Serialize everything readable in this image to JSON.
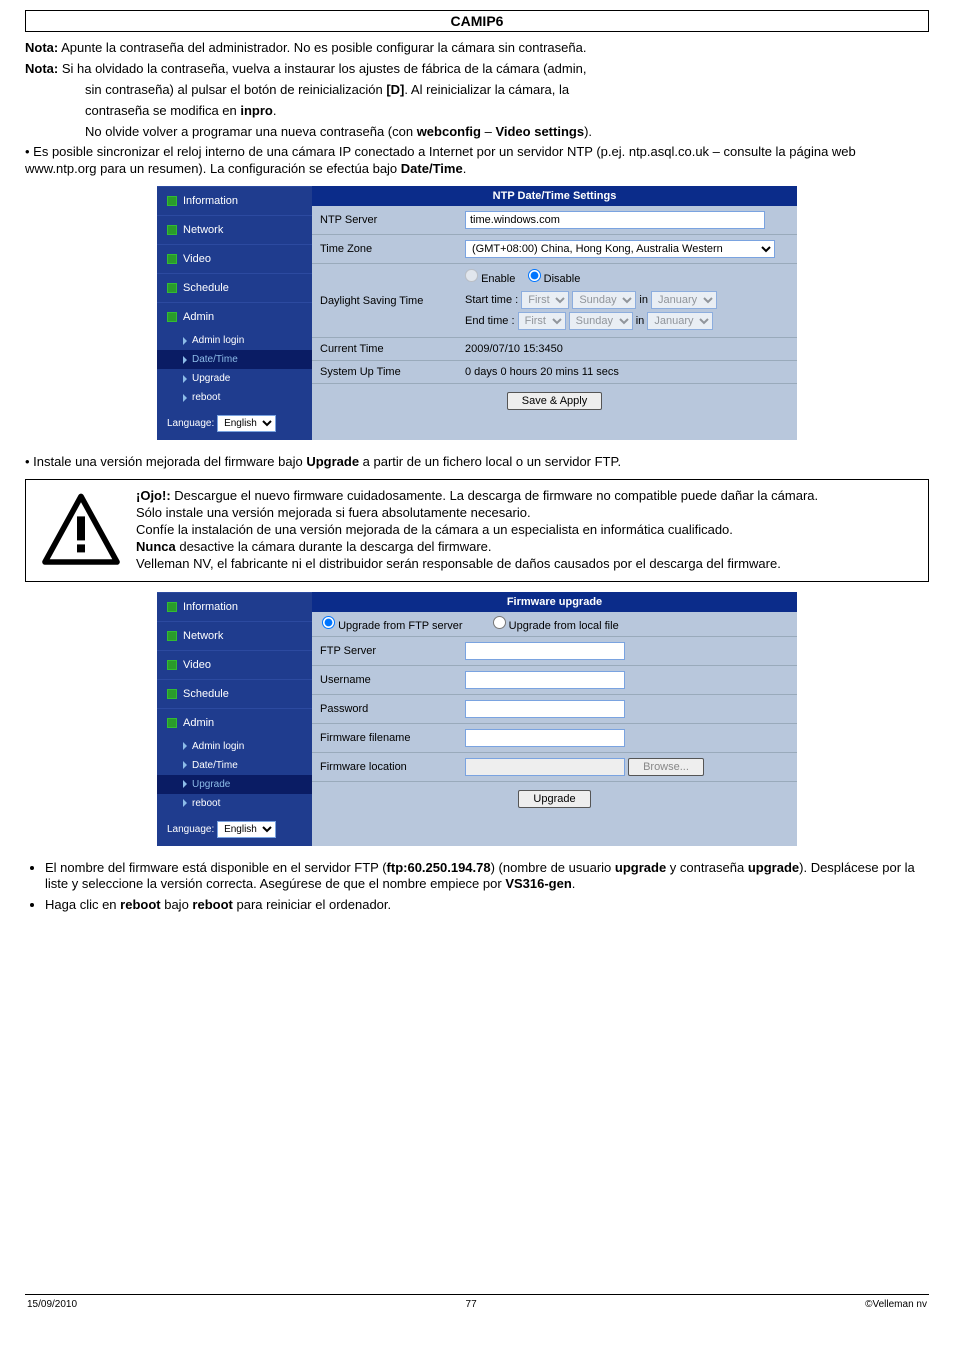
{
  "header": {
    "title": "CAMIP6"
  },
  "intro": {
    "nota1_b": "Nota:",
    "nota1_t": " Apunte la contraseña del administrador. No es posible configurar la cámara sin contraseña.",
    "nota2_b": "Nota:",
    "nota2_t": " Si ha olvidado la contraseña, vuelva a instaurar los ajustes de fábrica de la cámara (admin,",
    "nota2_c1": "sin contraseña) al pulsar el botón de reinicialización ",
    "nota2_c1b": "[D]",
    "nota2_c1t": ". Al reinicializar la cámara, la",
    "nota2_c2": "contraseña se modifica en ",
    "nota2_c2b": "inpro",
    "nota2_c2t": ".",
    "nota2_c3": "No olvide volver a programar una nueva contraseña (con ",
    "nota2_c3b": "webconfig",
    "nota2_c3m": " – ",
    "nota2_c3b2": "Video settings",
    "nota2_c3t": ").",
    "b1a": "Es posible sincronizar el reloj interno de una cámara IP conectado a Internet por un servidor NTP (p.ej. ntp.asql.co.uk – consulte la página web www.ntp.org para un resumen). La configuración se efectúa bajo ",
    "b1ab": "Date/Time",
    "b1at": "."
  },
  "ntp": {
    "hdr": "NTP Date/Time Settings",
    "s1": "Information",
    "s2": "Network",
    "s3": "Video",
    "s4": "Schedule",
    "s5": "Admin",
    "ss1": "Admin login",
    "ss2": "Date/Time",
    "ss3": "Upgrade",
    "ss4": "reboot",
    "lang_lbl": "Language:",
    "lang_val": "English",
    "r1l": "NTP Server",
    "r1v": "time.windows.com",
    "r2l": "Time Zone",
    "r2v": "(GMT+08:00) China, Hong Kong, Australia Western",
    "r3l": "Daylight Saving Time",
    "en": "Enable",
    "di": "Disable",
    "st": "Start time :",
    "et": "End time  :",
    "first": "First",
    "sunday": "Sunday",
    "inw": "in",
    "jan": "January",
    "r4l": "Current Time",
    "r4v": "2009/07/10 15:3450",
    "r5l": "System Up Time",
    "r5v": "0 days 0 hours 20 mins 11 secs",
    "btn": "Save & Apply"
  },
  "mid": {
    "b2": "Instale una versión mejorada del firmware bajo ",
    "b2b": "Upgrade",
    "b2t": " a partir de un fichero local o un servidor FTP."
  },
  "warn": {
    "l1b": "¡Ojo!:",
    "l1": " Descargue el nuevo firmware cuidadosamente. La descarga de firmware no compatible puede dañar la cámara.",
    "l2": "Sólo instale una versión mejorada si fuera absolutamente necesario.",
    "l3": "Confíe la instalación de una versión mejorada de la cámara a un especialista en informática cualificado.",
    "l4b": "Nunca",
    "l4": " desactive la cámara durante la descarga del firmware.",
    "l5": "Velleman NV, el fabricante ni el distribuidor serán responsable de daños causados por el descarga del firmware."
  },
  "fw": {
    "hdr": "Firmware upgrade",
    "opt1": "Upgrade from FTP server",
    "opt2": "Upgrade from local file",
    "r1": "FTP Server",
    "r2": "Username",
    "r3": "Password",
    "r4": "Firmware filename",
    "r5": "Firmware location",
    "browse": "Browse...",
    "up": "Upgrade"
  },
  "tail": {
    "t1a": "El nombre del firmware está disponible en el servidor FTP (",
    "t1b": "ftp:60.250.194.78",
    "t1c": ") (nombre de usuario ",
    "t1d": "upgrade",
    "t1e": " y contraseña ",
    "t1f": "upgrade",
    "t1g": "). Desplácese por la liste y seleccione la versión correcta. Asegúrese de que el nombre empiece por ",
    "t1h": "VS316-gen",
    "t1i": ".",
    "t2a": "Haga clic en ",
    "t2b": "reboot",
    "t2c": " bajo ",
    "t2d": "reboot",
    "t2e": " para reiniciar el ordenador."
  },
  "footer": {
    "l": "15/09/2010",
    "c": "77",
    "r": "©Velleman nv"
  }
}
